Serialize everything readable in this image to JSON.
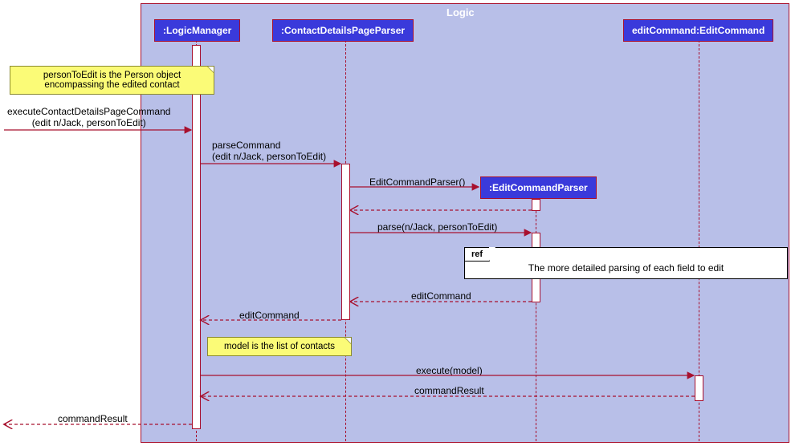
{
  "frame": {
    "title": "Logic"
  },
  "participants": {
    "logicManager": ":LogicManager",
    "contactDetailsPageParser": ":ContactDetailsPageParser",
    "editCommandParser": ":EditCommandParser",
    "editCommand": "editCommand:EditCommand"
  },
  "notes": {
    "personToEdit": "personToEdit is the Person object\nencompassing the edited contact",
    "model": "model is the list of contacts"
  },
  "ref": {
    "label": "ref",
    "text": "The more detailed parsing of each field to edit"
  },
  "messages": {
    "executeContactDetails": "executeContactDetailsPageCommand\n(edit n/Jack, personToEdit)",
    "parseCommand": "parseCommand\n(edit n/Jack, personToEdit)",
    "editCommandParserCtor": "EditCommandParser()",
    "parse": "parse(n/Jack, personToEdit)",
    "editCommandReturn1": "editCommand",
    "editCommandReturn2": "editCommand",
    "executeModel": "execute(model)",
    "commandResultReturn": "commandResult",
    "commandResultFinal": "commandResult"
  },
  "chart_data": {
    "type": "sequence-diagram",
    "frame": "Logic",
    "participants": [
      {
        "id": "LogicManager",
        "label": ":LogicManager"
      },
      {
        "id": "ContactDetailsPageParser",
        "label": ":ContactDetailsPageParser"
      },
      {
        "id": "EditCommandParser",
        "label": ":EditCommandParser",
        "created_by_message": 3
      },
      {
        "id": "EditCommand",
        "label": "editCommand:EditCommand"
      }
    ],
    "notes": [
      {
        "attached_to": "LogicManager",
        "text": "personToEdit is the Person object encompassing the edited contact"
      },
      {
        "attached_to": "LogicManager",
        "text": "model is the list of contacts"
      }
    ],
    "interaction_ref": {
      "over": "EditCommandParser",
      "text": "The more detailed parsing of each field to edit"
    },
    "messages": [
      {
        "seq": 1,
        "from": "external",
        "to": "LogicManager",
        "label": "executeContactDetailsPageCommand(edit n/Jack, personToEdit)",
        "type": "sync"
      },
      {
        "seq": 2,
        "from": "LogicManager",
        "to": "ContactDetailsPageParser",
        "label": "parseCommand(edit n/Jack, personToEdit)",
        "type": "sync"
      },
      {
        "seq": 3,
        "from": "ContactDetailsPageParser",
        "to": "EditCommandParser",
        "label": "EditCommandParser()",
        "type": "create"
      },
      {
        "seq": 4,
        "from": "EditCommandParser",
        "to": "ContactDetailsPageParser",
        "label": "",
        "type": "return"
      },
      {
        "seq": 5,
        "from": "ContactDetailsPageParser",
        "to": "EditCommandParser",
        "label": "parse(n/Jack, personToEdit)",
        "type": "sync"
      },
      {
        "seq": 6,
        "from": "EditCommandParser",
        "to": "ContactDetailsPageParser",
        "label": "editCommand",
        "type": "return"
      },
      {
        "seq": 7,
        "from": "ContactDetailsPageParser",
        "to": "LogicManager",
        "label": "editCommand",
        "type": "return"
      },
      {
        "seq": 8,
        "from": "LogicManager",
        "to": "EditCommand",
        "label": "execute(model)",
        "type": "sync"
      },
      {
        "seq": 9,
        "from": "EditCommand",
        "to": "LogicManager",
        "label": "commandResult",
        "type": "return"
      },
      {
        "seq": 10,
        "from": "LogicManager",
        "to": "external",
        "label": "commandResult",
        "type": "return"
      }
    ]
  }
}
